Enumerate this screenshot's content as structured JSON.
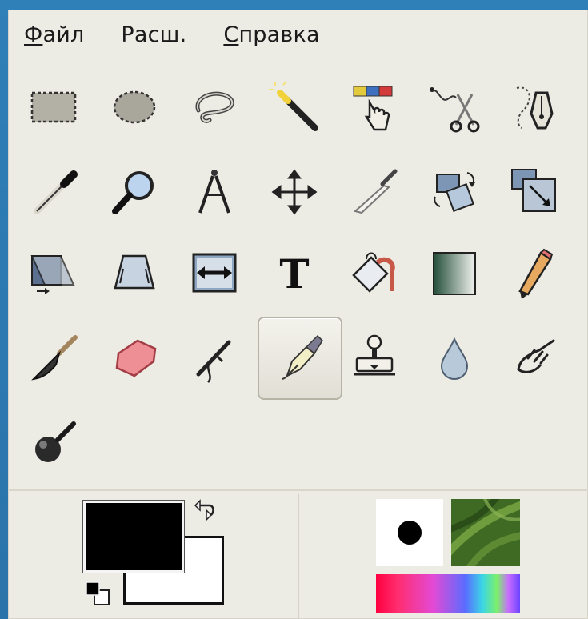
{
  "menu": {
    "items": [
      {
        "label": "Файл",
        "mnemonic": "Ф",
        "rest": "айл"
      },
      {
        "label": "Расш.",
        "mnemonic": "",
        "rest": "Расш."
      },
      {
        "label": "Справка",
        "mnemonic": "С",
        "rest": "правка"
      }
    ]
  },
  "toolbox": {
    "tools": [
      {
        "icon": "rect-select-icon"
      },
      {
        "icon": "ellipse-select-icon"
      },
      {
        "icon": "free-select-icon"
      },
      {
        "icon": "fuzzy-select-icon"
      },
      {
        "icon": "select-by-color-icon"
      },
      {
        "icon": "scissors-select-icon"
      },
      {
        "icon": "foreground-select-icon"
      },
      {
        "icon": "color-picker-icon"
      },
      {
        "icon": "magnify-icon"
      },
      {
        "icon": "measure-icon"
      },
      {
        "icon": "move-icon"
      },
      {
        "icon": "crop-icon"
      },
      {
        "icon": "rotate-icon"
      },
      {
        "icon": "scale-icon"
      },
      {
        "icon": "shear-icon"
      },
      {
        "icon": "perspective-icon"
      },
      {
        "icon": "flip-icon"
      },
      {
        "icon": "text-icon",
        "glyph": "T"
      },
      {
        "icon": "bucket-fill-icon"
      },
      {
        "icon": "blend-icon"
      },
      {
        "icon": "pencil-icon"
      },
      {
        "icon": "paintbrush-icon"
      },
      {
        "icon": "eraser-icon"
      },
      {
        "icon": "airbrush-icon"
      },
      {
        "icon": "ink-icon",
        "active": true
      },
      {
        "icon": "clone-icon"
      },
      {
        "icon": "blur-icon"
      },
      {
        "icon": "smudge-icon"
      },
      {
        "icon": "dodge-burn-icon"
      }
    ],
    "active_index": 24
  },
  "colors": {
    "foreground": "#000000",
    "background": "#ffffff",
    "accent_panel": "#ecebe4",
    "desktop": "#2f7fb8"
  }
}
